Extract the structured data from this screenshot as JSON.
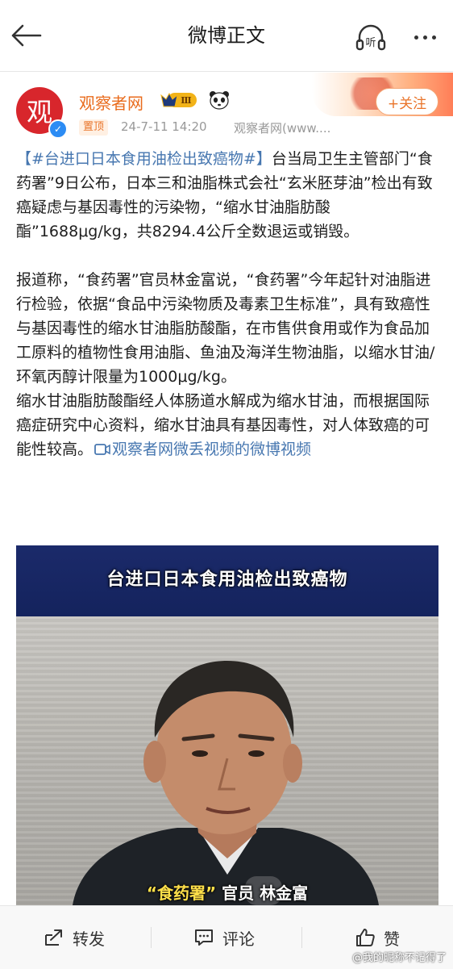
{
  "header": {
    "title": "微博正文",
    "listen_label": "听"
  },
  "author": {
    "avatar_text": "观",
    "name": "观察者网",
    "vip_level": "Ⅲ",
    "follow_label": "+关注",
    "pin_label": "置顶",
    "time": "24-7-11 14:20",
    "source": "观察者网(www...."
  },
  "post": {
    "hashtag": "【#台进口日本食用油检出致癌物#】",
    "para1": "台当局卫生主管部门“食药署”9日公布，日本三和油脂株式会社“玄米胚芽油”检出有致癌疑虑与基因毒性的污染物，“缩水甘油脂肪酸酯”1688μg/kg，共8294.4公斤全数退运或销毁。",
    "para2": "报道称，“食药署”官员林金富说，“食药署”今年起针对油脂进行检验，依据“食品中污染物质及毒素卫生标准”，具有致癌性与基因毒性的缩水甘油脂肪酸酯，在市售供食用或作为食品加工原料的植物性食用油脂、鱼油及海洋生物油脂，以缩水甘油/环氧丙醇计限量为1000μg/kg。",
    "para3": "缩水甘油脂肪酸酯经人体肠道水解成为缩水甘油，而根据国际癌症研究中心资料，缩水甘油具有基因毒性，对人体致癌的可能性较高。",
    "video_link": "观察者网微丢视频的微博视频"
  },
  "video": {
    "header_text": "台进口日本食用油检出致癌物",
    "caption_quote": "“食药署”",
    "caption_rest": "官员 林金富"
  },
  "actions": {
    "repost_label": "转发",
    "comment_label": "评论",
    "like_label": "赞"
  },
  "watermark": "@我的昵称不记得了",
  "colors": {
    "link": "#4777b0",
    "author_name": "#e96b1c",
    "follow": "#e9742a"
  }
}
